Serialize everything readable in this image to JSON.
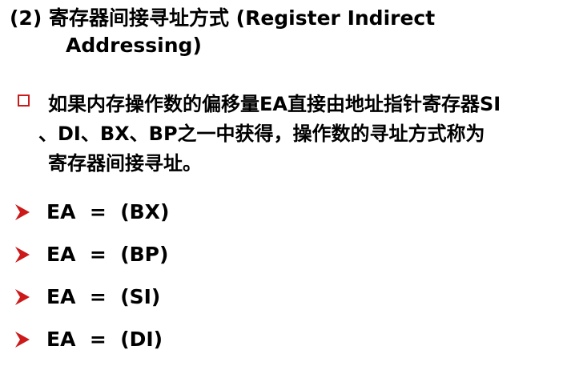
{
  "heading": {
    "line1": "(2) 寄存器间接寻址方式 (Register Indirect",
    "line2": "Addressing)"
  },
  "bullet": {
    "icon": "hollow-square-icon",
    "line1": "如果内存操作数的偏移量EA直接由地址指针寄存器SI",
    "line2": "、DI、BX、BP之一中获得，操作数的寻址方式称为",
    "line3": "寄存器间接寻址。"
  },
  "equations": [
    {
      "text": "EA  =  (BX)"
    },
    {
      "text": "EA  =  (BP)"
    },
    {
      "text": "EA  =  (SI)"
    },
    {
      "text": "EA  =  (DI)"
    }
  ],
  "colors": {
    "accent": "#cc1a1a",
    "text": "#000000"
  }
}
